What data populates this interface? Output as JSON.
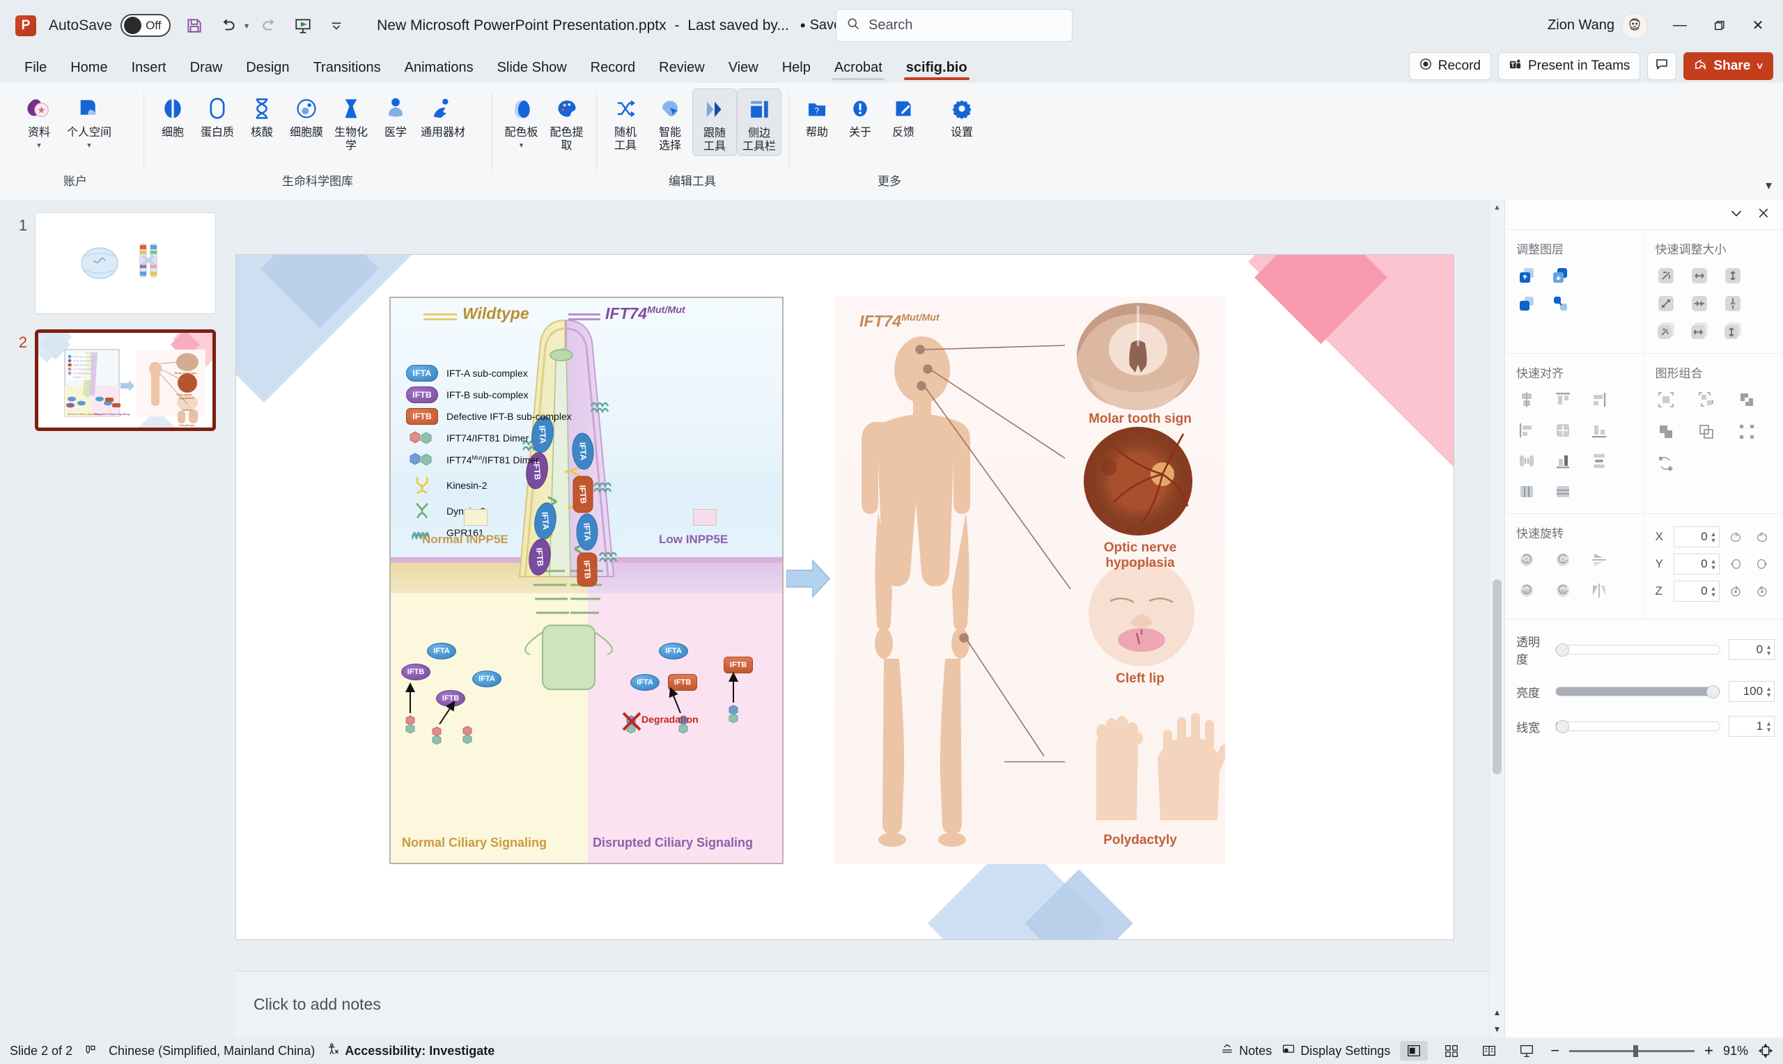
{
  "titlebar": {
    "autosave_label": "AutoSave",
    "autosave_state": "Off",
    "document_title": "New Microsoft PowerPoint Presentation.pptx",
    "title_separator": "-",
    "last_saved": "Last saved by...",
    "save_location": "Saved to this PC",
    "user_name": "Zion Wang",
    "icons": {
      "save": "save-icon",
      "undo": "undo-icon",
      "redo": "redo-icon",
      "present": "start-slideshow-icon",
      "customize": "customize-quick-access-icon"
    },
    "window": {
      "minimize": "—",
      "restore": "❐",
      "close": "✕"
    }
  },
  "search": {
    "placeholder": "Search"
  },
  "ribbon_tabs": {
    "items": [
      {
        "label": "File"
      },
      {
        "label": "Home"
      },
      {
        "label": "Insert"
      },
      {
        "label": "Draw"
      },
      {
        "label": "Design"
      },
      {
        "label": "Transitions"
      },
      {
        "label": "Animations"
      },
      {
        "label": "Slide Show"
      },
      {
        "label": "Record"
      },
      {
        "label": "Review"
      },
      {
        "label": "View"
      },
      {
        "label": "Help"
      },
      {
        "label": "Acrobat"
      },
      {
        "label": "scifig.bio"
      }
    ],
    "active": "scifig.bio",
    "right_buttons": [
      {
        "label": "Record",
        "icon": "record-icon"
      },
      {
        "label": "Present in Teams",
        "icon": "teams-icon"
      },
      {
        "label": "",
        "icon": "comment-icon"
      },
      {
        "label": "Share",
        "icon": "share-icon",
        "caret": "˅"
      }
    ]
  },
  "ribbon": {
    "groups": [
      {
        "title": "账户",
        "items": [
          {
            "label": "资料",
            "icon": "library-icon",
            "caret": true,
            "active": false
          },
          {
            "label": "个人空间",
            "icon": "personal-space-icon",
            "caret": true,
            "active": false
          }
        ]
      },
      {
        "title": "生命科学图库",
        "items": [
          {
            "label": "细胞",
            "icon": "cell-icon",
            "active": false
          },
          {
            "label": "蛋白质",
            "icon": "protein-icon",
            "active": false
          },
          {
            "label": "核酸",
            "icon": "dna-icon",
            "active": false
          },
          {
            "label": "细胞膜",
            "icon": "membrane-icon",
            "active": false
          },
          {
            "label": "生物化学",
            "icon": "biochem-icon",
            "active": false
          },
          {
            "label": "医学",
            "icon": "medicine-icon",
            "active": false
          },
          {
            "label": "通用器材",
            "icon": "labware-icon",
            "active": false
          }
        ]
      },
      {
        "title": "",
        "items": [
          {
            "label": "配色板",
            "icon": "palette-board-icon",
            "caret": true,
            "active": false
          },
          {
            "label": "配色提取",
            "icon": "palette-pick-icon",
            "active": false
          }
        ]
      },
      {
        "title": "编辑工具",
        "items": [
          {
            "label": "随机\n工具",
            "icon": "shuffle-icon",
            "active": false
          },
          {
            "label": "智能\n选择",
            "icon": "smart-select-icon",
            "active": false
          },
          {
            "label": "跟随\n工具",
            "icon": "follow-tool-icon",
            "active": true
          },
          {
            "label": "侧边\n工具栏",
            "icon": "side-toolbar-icon",
            "active": true
          }
        ]
      },
      {
        "title": "更多",
        "items": [
          {
            "label": "帮助",
            "icon": "help-icon",
            "active": false
          },
          {
            "label": "关于",
            "icon": "about-icon",
            "active": false
          },
          {
            "label": "反馈",
            "icon": "feedback-icon",
            "active": false
          },
          {
            "label": "设置",
            "icon": "settings-icon",
            "active": false
          }
        ]
      }
    ],
    "collapse_icon": "collapse-ribbon-icon"
  },
  "thumbnails": [
    {
      "number": "1",
      "selected": false
    },
    {
      "number": "2",
      "selected": true
    }
  ],
  "notes": {
    "placeholder": "Click to add notes"
  },
  "right_panel": {
    "header": {
      "collapse_icon": "chevron-down-icon",
      "close_icon": "close-icon"
    },
    "sections": [
      {
        "title": "调整图层",
        "icons": [
          "bring-to-front-icon",
          "send-to-back-icon",
          "bring-forward-icon",
          "send-backward-icon"
        ]
      },
      {
        "title": "快速调整大小",
        "icons": [
          "scale-both-icon",
          "scale-width-icon",
          "scale-height-icon",
          "shrink-both-icon",
          "shrink-width-icon",
          "shrink-height-icon",
          "match-both-icon",
          "match-width-icon",
          "match-height-icon"
        ]
      },
      {
        "title": "快速对齐",
        "icons": [
          "align-center-h-icon",
          "align-top-icon",
          "align-right-icon",
          "align-left-icon",
          "align-middle-icon",
          "align-bottom-icon",
          "distribute-h-icon",
          "distribute-v-icon",
          "distribute-even-icon",
          "grid-cols-icon",
          "grid-rows-icon"
        ]
      },
      {
        "title": "图形组合",
        "icons": [
          "group-icon",
          "ungroup-icon",
          "union-icon",
          "subtract-icon",
          "intersect-icon",
          "boundary-icon",
          "convert-shape-icon"
        ]
      },
      {
        "title": "快速旋转",
        "icons": [
          "rotate-left-1-icon",
          "rotate-right-1-icon",
          "flip-vertical-icon",
          "rotate-left-90-icon",
          "rotate-right-90-icon",
          "flip-horizontal-icon"
        ]
      }
    ],
    "rotation": [
      {
        "axis": "X",
        "value": "0",
        "cw_icon": "rotate-x-cw-icon",
        "ccw_icon": "rotate-x-ccw-icon"
      },
      {
        "axis": "Y",
        "value": "0",
        "cw_icon": "rotate-y-cw-icon",
        "ccw_icon": "rotate-y-ccw-icon"
      },
      {
        "axis": "Z",
        "value": "0",
        "cw_icon": "rotate-z-cw-icon",
        "ccw_icon": "rotate-z-ccw-icon"
      }
    ],
    "sliders": [
      {
        "label": "透明度",
        "value": "0",
        "percent": 0
      },
      {
        "label": "亮度",
        "value": "100",
        "percent": 100
      },
      {
        "label": "线宽",
        "value": "1",
        "percent": 1
      }
    ]
  },
  "statusbar": {
    "slide_counter": "Slide 2 of 2",
    "spellcheck_icon": "spellcheck-icon",
    "language": "Chinese (Simplified, Mainland China)",
    "accessibility_icon": "accessibility-icon",
    "accessibility": "Accessibility: Investigate",
    "notes_btn": "Notes",
    "notes_icon": "notes-icon",
    "display_settings_btn": "Display Settings",
    "display_settings_icon": "display-settings-icon",
    "views": [
      {
        "name": "normal-view",
        "active": true
      },
      {
        "name": "slide-sorter-view",
        "active": false
      },
      {
        "name": "reading-view",
        "active": false
      },
      {
        "name": "slideshow-view",
        "active": false
      }
    ],
    "zoom_out": "−",
    "zoom_in": "+",
    "zoom_level": "91%",
    "fit_icon": "fit-slide-icon"
  },
  "slide": {
    "figure": {
      "legend_title_wildtype": "Wildtype",
      "legend_title_mutant": "IFT74",
      "legend_title_mutant_sup": "Mut/Mut",
      "legend_items": [
        {
          "chip": "IFTA",
          "type": "a",
          "label": "IFT-A sub-complex"
        },
        {
          "chip": "IFTB",
          "type": "b",
          "label": "IFT-B sub-complex"
        },
        {
          "chip": "IFTB",
          "type": "d",
          "label": "Defective IFT-B sub-complex"
        },
        {
          "chip": "",
          "type": "dimer1",
          "label": "IFT74/IFT81 Dimer"
        },
        {
          "chip": "",
          "type": "dimer2",
          "label": "IFT74",
          "label_sup": "Mut",
          "label_tail": "/IFT81 Dimer"
        },
        {
          "chip": "",
          "type": "kinesin",
          "label": "Kinesin-2"
        },
        {
          "chip": "",
          "type": "dynein",
          "label": "Dynein-2"
        },
        {
          "chip": "",
          "type": "gpr",
          "label": "GPR161"
        }
      ],
      "zone_labels": [
        {
          "text": "Normal INPP5E",
          "color": "#c49a4e"
        },
        {
          "text": "Low INPP5E",
          "color": "#8e5fa9"
        }
      ],
      "signaling_labels": [
        {
          "text": "Normal Ciliary Signaling",
          "color": "#c99a40"
        },
        {
          "text": "Disrupted Ciliary Signaling",
          "color": "#8e5fa9"
        }
      ],
      "degradation_label": "Degradation",
      "bubbles_left": [
        "IFTA",
        "IFTB",
        "IFTB",
        "IFTA"
      ],
      "bubbles_right": [
        "IFTA",
        "IFTA",
        "IFTB",
        "IFTB"
      ],
      "mutant_title": "IFT74",
      "mutant_title_sup": "Mut/Mut",
      "phenotypes": [
        {
          "label": "Molar tooth sign",
          "image": "brain-mri-icon"
        },
        {
          "label": "Optic nerve\nhypoplasia",
          "image": "fundus-icon"
        },
        {
          "label": "Cleft lip",
          "image": "infant-face-icon"
        },
        {
          "label": "Polydactyly",
          "image": "hand-foot-icon"
        }
      ]
    }
  }
}
